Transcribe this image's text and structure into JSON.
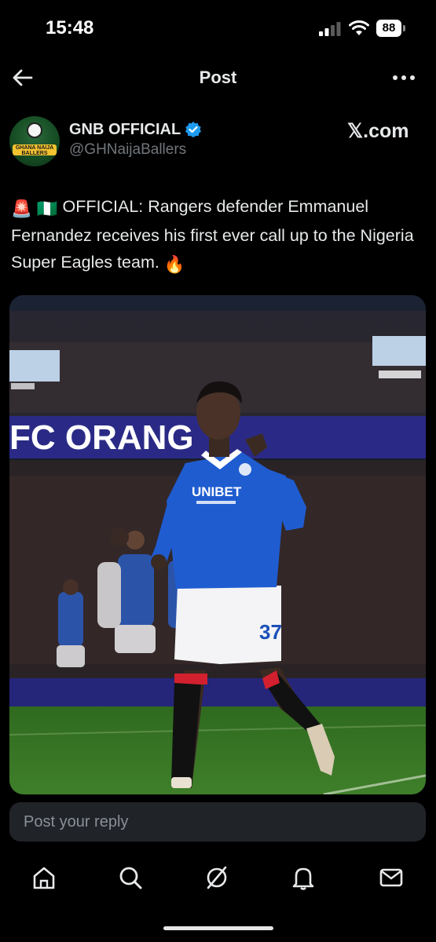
{
  "status_bar": {
    "time": "15:48",
    "battery": "88"
  },
  "header": {
    "title": "Post"
  },
  "author": {
    "name": "GNB OFFICIAL",
    "handle": "@GHNaijaBallers",
    "avatar_text": "GHANA NAIJA BALLERS",
    "source_logo": "𝕏.com"
  },
  "post": {
    "emoji_siren": "🚨",
    "emoji_flag": "🇳🇬",
    "text": " OFFICIAL: Rangers defender Emmanuel Fernandez receives his first ever call up to the Nigeria Super Eagles team. ",
    "emoji_fire": "🔥"
  },
  "media": {
    "banner_text": "FC  ORANG",
    "shirt_sponsor": "UNIBET",
    "shirt_number": "37"
  },
  "reply": {
    "placeholder": "Post your reply"
  },
  "tabs": [
    "home-icon",
    "search-icon",
    "grok-icon",
    "notifications-icon",
    "messages-icon"
  ],
  "colors": {
    "accent": "#1d9bf0",
    "background": "#000000",
    "muted": "#71767b"
  }
}
